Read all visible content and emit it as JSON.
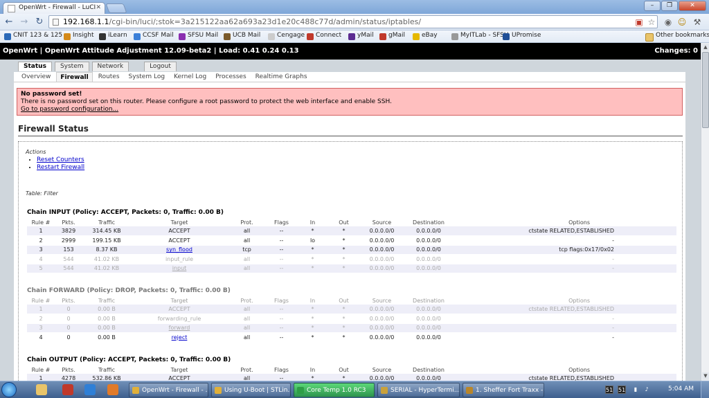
{
  "browser": {
    "tab_title": "OpenWrt - Firewall - LuCI",
    "url_host": "192.168.1.1",
    "url_path": "/cgi-bin/luci/;stok=3a215122aa62a693a23d1e20c488c77d/admin/status/iptables/",
    "icons": {
      "back": "back-arrow-icon",
      "forward": "forward-arrow-icon",
      "reload": "reload-icon",
      "star": "star-icon",
      "menu": "wrench-icon"
    },
    "bookmarks": [
      {
        "label": "CNIT 123 & 125",
        "color": "#2c6ab8"
      },
      {
        "label": "Insight",
        "color": "#d48a1a"
      },
      {
        "label": "iLearn",
        "color": "#333333"
      },
      {
        "label": "CCSF Mail",
        "color": "#3b7fd8"
      },
      {
        "label": "SFSU Mail",
        "color": "#8a2fb0"
      },
      {
        "label": "UCB Mail",
        "color": "#7b5b2c"
      },
      {
        "label": "Cengage",
        "color": "#cccccc"
      },
      {
        "label": "Connect",
        "color": "#c0392b"
      },
      {
        "label": "yMail",
        "color": "#5b2b91"
      },
      {
        "label": "gMail",
        "color": "#c0392b"
      },
      {
        "label": "eBay",
        "color": "#e5b800"
      },
      {
        "label": "MyITLab - SFSU",
        "color": "#999999"
      },
      {
        "label": "UPromise",
        "color": "#1f4e96"
      }
    ],
    "other_bookmarks": "Other bookmarks"
  },
  "luci": {
    "header_text": "OpenWrt | OpenWrt Attitude Adjustment 12.09-beta2 | Load: 0.41 0.24 0.13",
    "changes": "Changes: 0",
    "main_tabs": [
      "Status",
      "System",
      "Network",
      "Logout"
    ],
    "sub_tabs": [
      "Overview",
      "Firewall",
      "Routes",
      "System Log",
      "Kernel Log",
      "Processes",
      "Realtime Graphs"
    ],
    "alert": {
      "title": "No password set!",
      "message": "There is no password set on this router. Please configure a root password to protect the web interface and enable SSH.",
      "link": "Go to password configuration..."
    },
    "page_title": "Firewall Status",
    "actions_legend": "Actions",
    "actions": [
      "Reset Counters",
      "Restart Firewall"
    ],
    "table_legend": "Table: Filter",
    "columns": [
      "Rule #",
      "Pkts.",
      "Traffic",
      "Target",
      "Prot.",
      "Flags",
      "In",
      "Out",
      "Source",
      "Destination",
      "Options"
    ],
    "chains": [
      {
        "title": "Chain INPUT (Policy: ACCEPT, Packets: 0, Traffic: 0.00 B)",
        "rows": [
          [
            "1",
            "3829",
            "314.45 KB",
            "ACCEPT",
            "all",
            "--",
            "*",
            "*",
            "0.0.0.0/0",
            "0.0.0.0/0",
            "ctstate RELATED,ESTABLISHED"
          ],
          [
            "2",
            "2999",
            "199.15 KB",
            "ACCEPT",
            "all",
            "--",
            "lo",
            "*",
            "0.0.0.0/0",
            "0.0.0.0/0",
            "-"
          ],
          [
            "3",
            "153",
            "8.37 KB",
            "syn_flood",
            "tcp",
            "--",
            "*",
            "*",
            "0.0.0.0/0",
            "0.0.0.0/0",
            "tcp flags:0x17/0x02"
          ],
          [
            "4",
            "544",
            "41.02 KB",
            "input_rule",
            "all",
            "--",
            "*",
            "*",
            "0.0.0.0/0",
            "0.0.0.0/0",
            "-"
          ],
          [
            "5",
            "544",
            "41.02 KB",
            "input",
            "all",
            "--",
            "*",
            "*",
            "0.0.0.0/0",
            "0.0.0.0/0",
            "-"
          ]
        ]
      },
      {
        "title": "Chain FORWARD (Policy: DROP, Packets: 0, Traffic: 0.00 B)",
        "rows": [
          [
            "1",
            "0",
            "0.00 B",
            "ACCEPT",
            "all",
            "--",
            "*",
            "*",
            "0.0.0.0/0",
            "0.0.0.0/0",
            "ctstate RELATED,ESTABLISHED"
          ],
          [
            "2",
            "0",
            "0.00 B",
            "forwarding_rule",
            "all",
            "--",
            "*",
            "*",
            "0.0.0.0/0",
            "0.0.0.0/0",
            "-"
          ],
          [
            "3",
            "0",
            "0.00 B",
            "forward",
            "all",
            "--",
            "*",
            "*",
            "0.0.0.0/0",
            "0.0.0.0/0",
            "-"
          ],
          [
            "4",
            "0",
            "0.00 B",
            "reject",
            "all",
            "--",
            "*",
            "*",
            "0.0.0.0/0",
            "0.0.0.0/0",
            "-"
          ]
        ]
      },
      {
        "title": "Chain OUTPUT (Policy: ACCEPT, Packets: 0, Traffic: 0.00 B)",
        "rows": [
          [
            "1",
            "4278",
            "532.86 KB",
            "ACCEPT",
            "all",
            "--",
            "*",
            "*",
            "0.0.0.0/0",
            "0.0.0.0/0",
            "ctstate RELATED,ESTABLISHED"
          ]
        ]
      }
    ]
  },
  "taskbar": {
    "tasks": [
      {
        "label": "OpenWrt - Firewall - ...",
        "color": "#e0b03a"
      },
      {
        "label": "Using U-Boot | STLin...",
        "color": "#e0b03a"
      },
      {
        "label": "Core Temp 1.0 RC3",
        "color": "#2e9e46"
      },
      {
        "label": "SERIAL - HyperTermi...",
        "color": "#c9a13b"
      },
      {
        "label": "1. Sheffer Fort Traxx - ...",
        "color": "#b8862b"
      }
    ],
    "tray_values": [
      "51",
      "51"
    ],
    "clock": "5:04 AM"
  }
}
